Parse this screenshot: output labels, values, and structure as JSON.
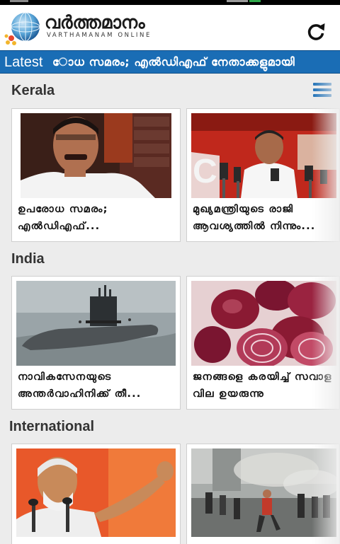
{
  "header": {
    "title": "വർത്തമാനം",
    "subtitle": "VARTHAMANAM ONLINE"
  },
  "ticker": {
    "label": "Latest",
    "text": "ോധ സമരം; എൽഡിഎഫ് നേതാക്കളുമായി"
  },
  "sections": [
    {
      "title": "Kerala",
      "cards": [
        {
          "line1": "ഉപരോധ സമരം;",
          "line2": "എൽഡിഎഫ്..."
        },
        {
          "line1": "മുഖ്യമന്ത്രിയുടെ രാജി",
          "line2": "ആവശ്യത്തിൽ നിന്നും..."
        }
      ]
    },
    {
      "title": "India",
      "cards": [
        {
          "line1": "നാവികസേനയുടെ",
          "line2": "അന്തർവാഹിനിക്ക് തീ..."
        },
        {
          "line1": "ജനങ്ങളെ കരയിച്ച് സവാള",
          "line2": "വില ഉയരുന്നു"
        }
      ]
    },
    {
      "title": "International",
      "cards": [
        {
          "line1": "",
          "line2": ""
        },
        {
          "line1": "",
          "line2": ""
        }
      ]
    }
  ],
  "icons": {
    "refresh": "refresh-icon",
    "menu": "menu-icon",
    "logo": "globe-logo-icon"
  },
  "colors": {
    "ticker_bg": "#1a6db5",
    "menu_icon": "#1a6db5",
    "page_bg": "#ececec"
  }
}
